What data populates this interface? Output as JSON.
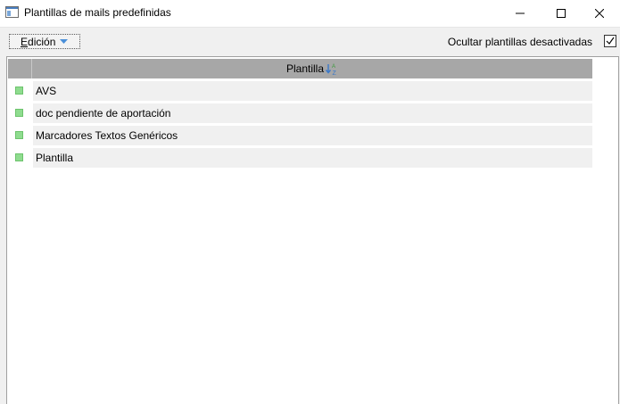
{
  "window": {
    "title": "Plantillas de mails predefinidas"
  },
  "toolbar": {
    "edicion_label": "Edición",
    "hide_inactive_label": "Ocultar plantillas desactivadas",
    "hide_inactive_checked": true
  },
  "grid": {
    "column_header": "Plantilla",
    "rows": [
      {
        "label": "AVS"
      },
      {
        "label": "doc pendiente de aportación"
      },
      {
        "label": "Marcadores Textos Genéricos"
      },
      {
        "label": "Plantilla"
      }
    ]
  },
  "colors": {
    "row_marker": "#8fdc8f",
    "header_bg": "#a7a7a7",
    "row_bg": "#f0f0f0"
  }
}
